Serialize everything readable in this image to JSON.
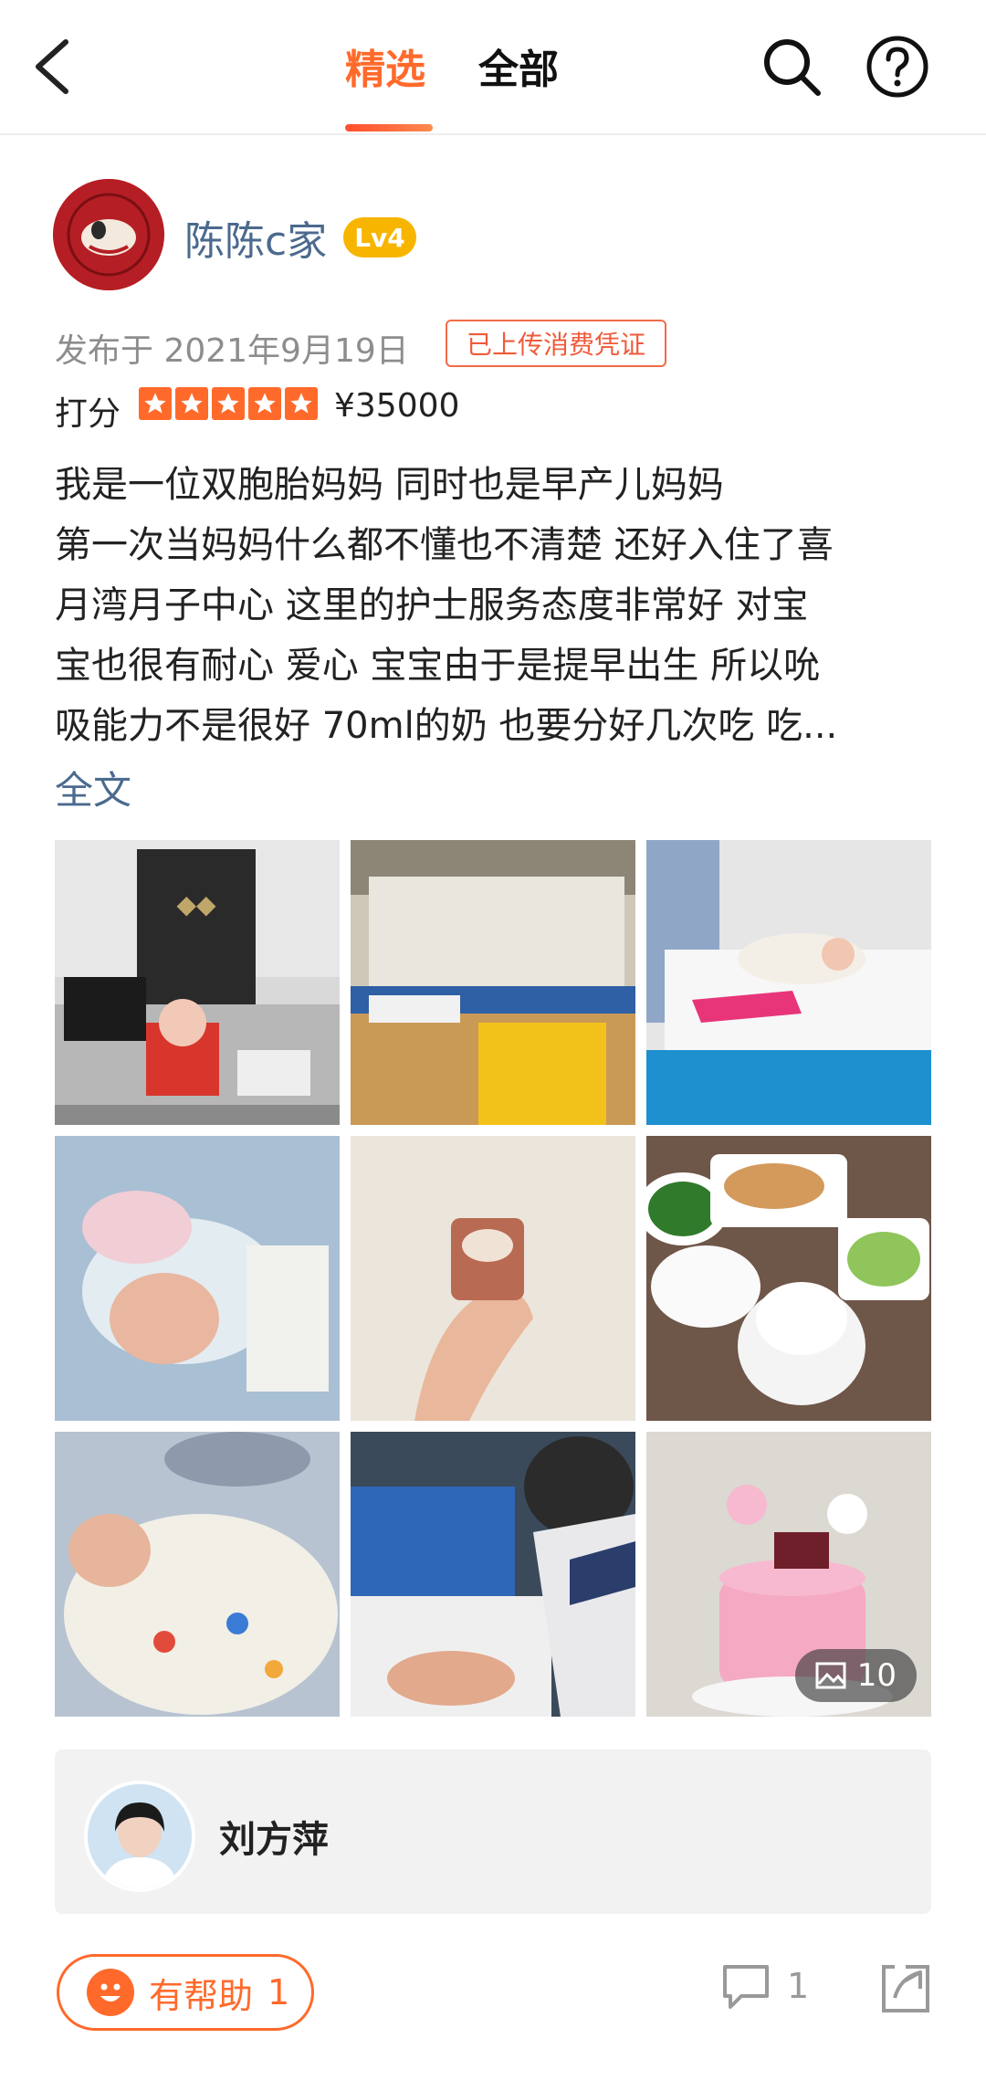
{
  "nav": {
    "tabs": [
      {
        "label": "精选",
        "selected": true
      },
      {
        "label": "全部",
        "selected": false
      }
    ],
    "icons": [
      "back-icon",
      "search-icon",
      "help-icon"
    ]
  },
  "post": {
    "username": "陈陈c家",
    "level": "Lv4",
    "publish_date": "发布于 2021年9月19日",
    "voucher_badge": "已上传消费凭证",
    "rating_label": "打分",
    "stars": 5,
    "price": "¥35000",
    "text_lines": [
      "我是一位双胞胎妈妈 同时也是早产儿妈妈",
      "第一次当妈妈什么都不懂也不清楚 还好入住了喜",
      "月湾月子中心 这里的护士服务态度非常好 对宝",
      "宝也很有耐心 爱心   宝宝由于是提早出生 所以吮",
      "吸能力不是很好 70ml的奶 也要分好几次吃 吃..."
    ],
    "full_text_link": "全文",
    "photos": [
      {
        "name": "photo-reception"
      },
      {
        "name": "photo-nursery-room"
      },
      {
        "name": "photo-nurse-baby"
      },
      {
        "name": "photo-baby-sleeping"
      },
      {
        "name": "photo-cup-hand"
      },
      {
        "name": "photo-meal"
      },
      {
        "name": "photo-baby-swaddle"
      },
      {
        "name": "photo-baby-bath"
      },
      {
        "name": "photo-cake"
      }
    ],
    "photo_count": "10"
  },
  "staff": {
    "name": "刘方萍"
  },
  "actions": {
    "helpful_label": "有帮助",
    "helpful_count": "1",
    "comment_count": "1"
  },
  "colors": {
    "accent": "#ff6a2b",
    "link": "#4b6a8e",
    "level_badge": "#f7b500"
  }
}
